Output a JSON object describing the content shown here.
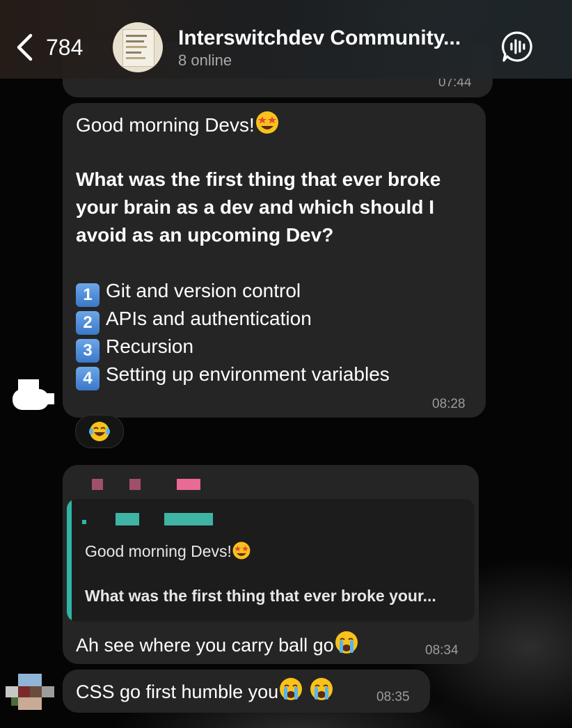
{
  "header": {
    "back_count": "784",
    "title": "Interswitchdev Community...",
    "subtitle": "8 online"
  },
  "prev_message": {
    "time": "07:44"
  },
  "poll_message": {
    "greeting": "Good morning Devs!",
    "question_lines": [
      "What was the first thing that ever broke",
      "your brain as a dev and which should I",
      "avoid as an upcoming Dev?"
    ],
    "options": [
      {
        "num": "1",
        "text": "Git and version control"
      },
      {
        "num": "2",
        "text": "APIs and authentication"
      },
      {
        "num": "3",
        "text": "Recursion"
      },
      {
        "num": "4",
        "text": "Setting up environment variables"
      }
    ],
    "time": "08:28",
    "reaction": "laughing-tears-emoji"
  },
  "reply_message": {
    "quoted_greeting": "Good morning Devs!",
    "quoted_text": "What was the first thing that ever broke your...",
    "text": "Ah see where you carry ball go",
    "time": "08:34"
  },
  "last_message": {
    "text": "CSS go first humble you",
    "time": "08:35"
  },
  "colors": {
    "bubble": "#252525",
    "reply_accent": "#2fb5a5",
    "background": "#050505"
  }
}
